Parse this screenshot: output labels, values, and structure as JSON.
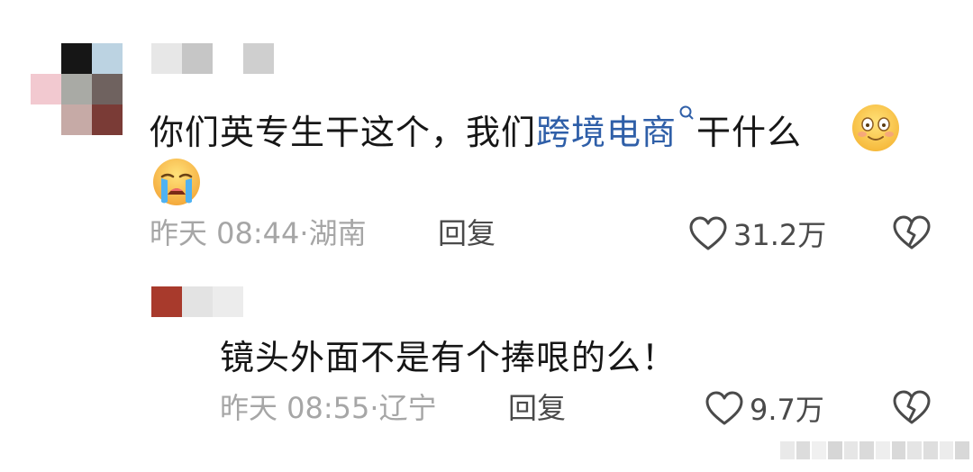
{
  "comments": [
    {
      "text_before": "你们英专生干这个，我们",
      "link_text": "跨境电商",
      "text_after": "干什么",
      "emojis": [
        "smiling-face-emoji",
        "crying-face-emoji"
      ],
      "time": "昨天 08:44",
      "location": "湖南",
      "reply_label": "回复",
      "likes": "31.2万"
    },
    {
      "text": "镜头外面不是有个捧哏的么！",
      "time": "昨天 08:55",
      "location": "辽宁",
      "reply_label": "回复",
      "likes": "9.7万"
    }
  ],
  "colors": {
    "link": "#2f5fa8",
    "meta": "#a6a6a6",
    "accent_red": "#a83a2c"
  }
}
